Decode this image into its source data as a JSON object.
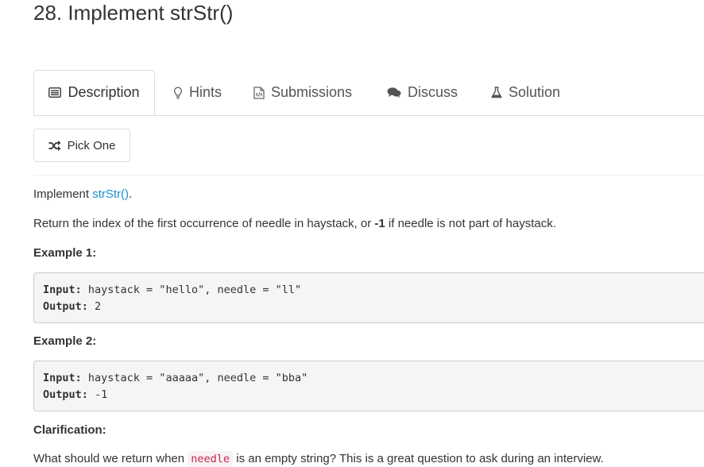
{
  "problem": {
    "title": "28. Implement strStr()"
  },
  "tabs": [
    {
      "label": "Description",
      "icon": "list-icon",
      "active": true
    },
    {
      "label": "Hints",
      "icon": "lightbulb-icon"
    },
    {
      "label": "Submissions",
      "icon": "code-file-icon"
    },
    {
      "label": "Discuss",
      "icon": "comments-icon"
    },
    {
      "label": "Solution",
      "icon": "flask-icon"
    }
  ],
  "pick_one": {
    "label": "Pick One",
    "icon": "shuffle-icon"
  },
  "description": {
    "intro_prefix": "Implement ",
    "intro_link": "strStr()",
    "intro_suffix": ".",
    "return_prefix": "Return the index of the first occurrence of needle in haystack, or ",
    "return_bold": "-1",
    "return_suffix": " if needle is not part of haystack."
  },
  "examples": [
    {
      "heading": "Example 1:",
      "input_label": "Input:",
      "input_value": " haystack = \"hello\", needle = \"ll\"",
      "output_label": "Output:",
      "output_value": " 2"
    },
    {
      "heading": "Example 2:",
      "input_label": "Input:",
      "input_value": " haystack = \"aaaaa\", needle = \"bba\"",
      "output_label": "Output:",
      "output_value": " -1"
    }
  ],
  "clarification": {
    "heading": "Clarification:",
    "text_prefix": "What should we return when ",
    "code": "needle",
    "text_suffix": " is an empty string? This is a great question to ask during an interview."
  },
  "colors": {
    "link": "#1a8fd2",
    "code_text": "#c7254e",
    "code_bg": "#f9f2f4",
    "pre_bg": "#f5f5f5",
    "border": "#dddddd"
  }
}
